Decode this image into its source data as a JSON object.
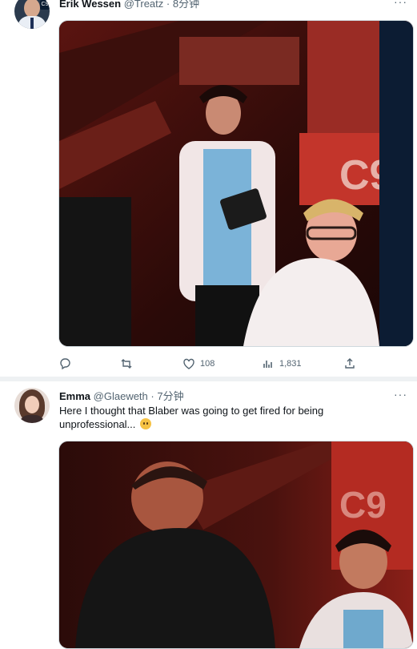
{
  "tweets": [
    {
      "author_name": "Erik Wessen",
      "author_handle": "@Treatz",
      "dot": "·",
      "time": "8分钟",
      "more": "···",
      "actions": {
        "reply_icon": "reply-icon",
        "retweet_icon": "retweet-icon",
        "like_icon": "heart-icon",
        "like_count": "108",
        "views_icon": "analytics-icon",
        "views_count": "1,831",
        "share_icon": "share-icon"
      }
    },
    {
      "author_name": "Emma",
      "author_handle": "@Glaeweth",
      "dot": "·",
      "time": "7分钟",
      "more": "···",
      "text": "Here I thought that Blaber was going to get fired for being unprofessional..."
    }
  ],
  "colors": {
    "text_primary": "#0f1419",
    "text_secondary": "#536471",
    "separator": "#eef1f3",
    "media_tint": "#b0231b"
  }
}
